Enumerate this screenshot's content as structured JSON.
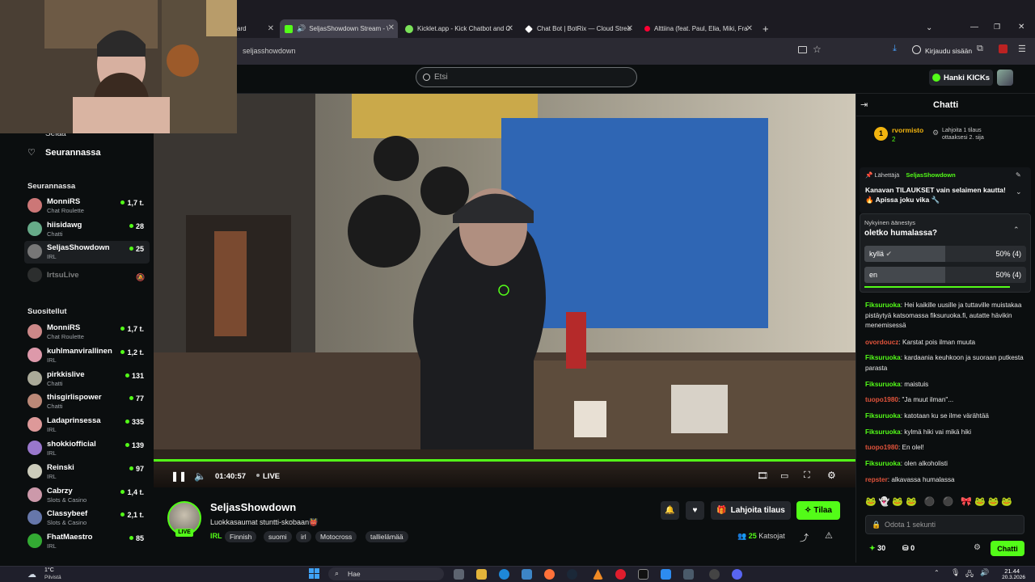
{
  "browser": {
    "tabs": [
      {
        "label": "ard",
        "icon": "dashboard-icon",
        "active": false
      },
      {
        "label": "SeljasShowdown Stream - \\",
        "icon": "kick-icon",
        "active": true
      },
      {
        "label": "Kicklet.app - Kick Chatbot and C",
        "icon": "kicklet-icon",
        "active": false
      },
      {
        "label": "Chat Bot | BotRix — Cloud Strea",
        "icon": "botrix-icon",
        "active": false
      },
      {
        "label": "Alttiina (feat. Paul, Elia, Miki, Fra",
        "icon": "youtube-icon",
        "active": false
      }
    ],
    "url": "seljasshowdown",
    "login_label": "Kirjaudu sisään"
  },
  "header": {
    "search_placeholder": "Etsi",
    "hanki_label": "Hanki KICKs"
  },
  "sidebar": {
    "top_item_partial": "Selaa",
    "following_link": "Seurannassa",
    "following_heading": "Seurannassa",
    "following": [
      {
        "name": "MonniRS",
        "category": "Chat Roulette",
        "viewers": "1,7 t."
      },
      {
        "name": "hiisidawg",
        "category": "Chatti",
        "viewers": "28"
      },
      {
        "name": "SeljasShowdown",
        "category": "IRL",
        "viewers": "25"
      },
      {
        "name": "IrtsuLive",
        "category": "",
        "viewers": ""
      }
    ],
    "recommended_heading": "Suositellut",
    "recommended": [
      {
        "name": "MonniRS",
        "category": "Chat Roulette",
        "viewers": "1,7 t."
      },
      {
        "name": "kuhlmanvirallinen",
        "category": "IRL",
        "viewers": "1,2 t."
      },
      {
        "name": "pirkkislive",
        "category": "Chatti",
        "viewers": "131"
      },
      {
        "name": "thisgirlispower",
        "category": "Chatti",
        "viewers": "77"
      },
      {
        "name": "Ladaprinsessa",
        "category": "IRL",
        "viewers": "335"
      },
      {
        "name": "shokkiofficial",
        "category": "IRL",
        "viewers": "139"
      },
      {
        "name": "Reinski",
        "category": "IRL",
        "viewers": "97"
      },
      {
        "name": "Cabrzy",
        "category": "Slots & Casino",
        "viewers": "1,4 t."
      },
      {
        "name": "Classybeef",
        "category": "Slots & Casino",
        "viewers": "2,1 t."
      },
      {
        "name": "FhatMaestro",
        "category": "IRL",
        "viewers": "85"
      }
    ]
  },
  "player": {
    "time": "01:40:57",
    "live_label": "LIVE",
    "progress": 1.0
  },
  "stream": {
    "channel": "SeljasShowdown",
    "title": "Luokkasaumat stuntti-skobaan👹",
    "live_badge": "LIVE",
    "tags": [
      "IRL",
      "Finnish",
      "suomi",
      "irl",
      "Motocross",
      "tallielämää"
    ],
    "viewers": "25",
    "viewers_label": "Katsojat",
    "gift_label": "Lahjoita tilaus",
    "subscribe_label": "Tilaa"
  },
  "chat": {
    "title": "Chatti",
    "leader": {
      "name": "rvormisto",
      "count": "2",
      "note": "Lahjoita 1 tilaus ottaaksesi 2. sija"
    },
    "pinned": {
      "by_label": "Lähettäjä",
      "by_user": "SeljasShowdown",
      "text": "Kanavan TILAUKSET vain selaimen kautta! 🔥 Apissa joku vika 🔧"
    },
    "poll": {
      "label": "Nykyinen äänestys",
      "question": "oletko humalassa?",
      "options": [
        {
          "label": "kyllä",
          "result": "50% (4)",
          "share": 0.5
        },
        {
          "label": "en",
          "result": "50% (4)",
          "share": 0.5
        }
      ]
    },
    "messages": [
      {
        "user": "Fiksuruoka",
        "color": "#53fc18",
        "text": "Hei kaikille uusille ja tuttaville muistakaa pistäytyä katsomassa fiksuruoka.fi, autatte hävikin menemisessä"
      },
      {
        "user": "ovordoucz",
        "color": "#e0533b",
        "text": "Karstat pois ilman muuta"
      },
      {
        "user": "Fiksuruoka",
        "color": "#53fc18",
        "text": "kardaania keuhkoon ja suoraan putkesta parasta"
      },
      {
        "user": "Fiksuruoka",
        "color": "#53fc18",
        "text": "maistuis"
      },
      {
        "user": "tuopo1980",
        "color": "#e0533b",
        "text": "\"Ja muut ilman\"..."
      },
      {
        "user": "Fiksuruoka",
        "color": "#53fc18",
        "text": "katotaan ku se ilme värähtää"
      },
      {
        "user": "Fiksuruoka",
        "color": "#53fc18",
        "text": "kylmä hiki vai mikä hiki"
      },
      {
        "user": "tuopo1980",
        "color": "#e0533b",
        "text": "En olel!"
      },
      {
        "user": "Fiksuruoka",
        "color": "#53fc18",
        "text": "olen alkoholisti"
      },
      {
        "user": "repster",
        "color": "#e0533b",
        "text": "alkavassa humalassa"
      }
    ],
    "input_placeholder": "Odota 1 sekunti",
    "points": "30",
    "drops": "0",
    "send_label": "Chatti"
  },
  "taskbar": {
    "weather_temp": "1°C",
    "weather_desc": "Pilvistä",
    "search_label": "Hae",
    "time": "21.44",
    "date": "20.3.2026"
  }
}
